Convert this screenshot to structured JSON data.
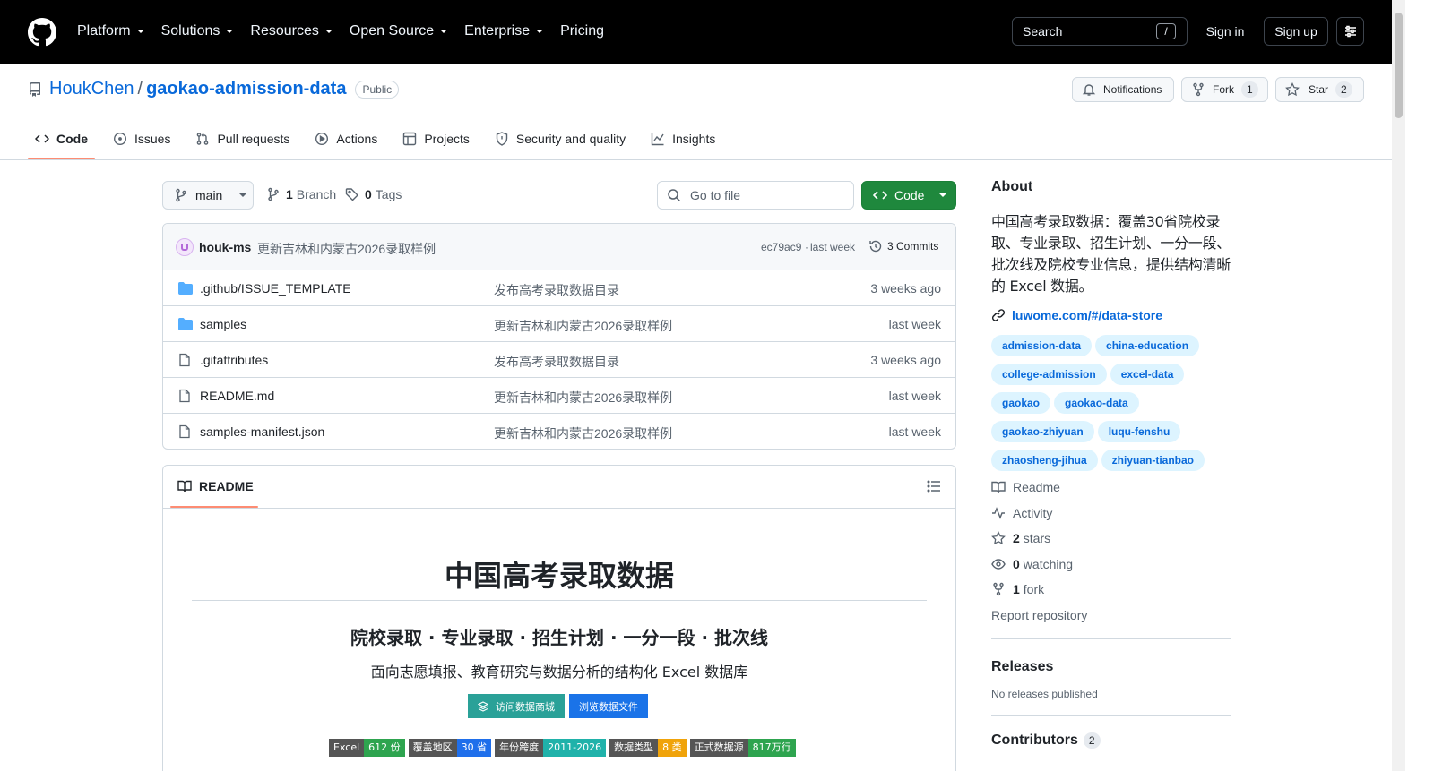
{
  "header": {
    "nav": [
      "Platform",
      "Solutions",
      "Resources",
      "Open Source",
      "Enterprise",
      "Pricing"
    ],
    "search_label": "Search",
    "search_kbd": "/",
    "sign_in": "Sign in",
    "sign_up": "Sign up"
  },
  "repo": {
    "owner": "HoukChen",
    "sep": "/",
    "name": "gaokao-admission-data",
    "visibility": "Public",
    "notifications_label": "Notifications",
    "fork_label": "Fork",
    "fork_count": "1",
    "star_label": "Star",
    "star_count": "2"
  },
  "tabs": [
    "Code",
    "Issues",
    "Pull requests",
    "Actions",
    "Projects",
    "Security and quality",
    "Insights"
  ],
  "toolbar": {
    "branch": "main",
    "branch_count": "1",
    "branch_label": "Branch",
    "tag_count": "0",
    "tag_label": "Tags",
    "goto_placeholder": "Go to file",
    "code_label": "Code"
  },
  "commit": {
    "author": "houk-ms",
    "message": "更新吉林和内蒙古2026录取样例",
    "hash": "ec79ac9",
    "dot": "·",
    "time": "last week",
    "commits_label": "3 Commits"
  },
  "files": [
    {
      "type": "folder",
      "name": ".github/ISSUE_TEMPLATE",
      "message": "发布高考录取数据目录",
      "time": "3 weeks ago"
    },
    {
      "type": "folder",
      "name": "samples",
      "message": "更新吉林和内蒙古2026录取样例",
      "time": "last week"
    },
    {
      "type": "file",
      "name": ".gitattributes",
      "message": "发布高考录取数据目录",
      "time": "3 weeks ago"
    },
    {
      "type": "file",
      "name": "README.md",
      "message": "更新吉林和内蒙古2026录取样例",
      "time": "last week"
    },
    {
      "type": "file",
      "name": "samples-manifest.json",
      "message": "更新吉林和内蒙古2026录取样例",
      "time": "last week"
    }
  ],
  "readme": {
    "tab_label": "README",
    "title": "中国高考录取数据",
    "subtitle": "院校录取 · 专业录取 · 招生计划 · 一分一段 · 批次线",
    "description": "面向志愿填报、教育研究与数据分析的结构化 Excel 数据库",
    "btn_store": "访问数据商城",
    "btn_browse": "浏览数据文件",
    "shields": [
      {
        "label": "Excel",
        "value": "612 份",
        "color": "#2ea44f"
      },
      {
        "label": "覆盖地区",
        "value": "30 省",
        "color": "#1f6feb"
      },
      {
        "label": "年份跨度",
        "value": "2011-2026",
        "color": "#20b2aa"
      },
      {
        "label": "数据类型",
        "value": "8 类",
        "color": "#f0a30a"
      },
      {
        "label": "正式数据源",
        "value": "817万行",
        "color": "#2ea44f"
      }
    ]
  },
  "about": {
    "heading": "About",
    "description": "中国高考录取数据：覆盖30省院校录取、专业录取、招生计划、一分一段、批次线及院校专业信息，提供结构清晰的 Excel 数据。",
    "link": "luwome.com/#/data-store",
    "topics": [
      "admission-data",
      "china-education",
      "college-admission",
      "excel-data",
      "gaokao",
      "gaokao-data",
      "gaokao-zhiyuan",
      "luqu-fenshu",
      "zhaosheng-jihua",
      "zhiyuan-tianbao"
    ],
    "readme": "Readme",
    "activity": "Activity",
    "stars_count": "2",
    "stars_label": "stars",
    "watching_count": "0",
    "watching_label": "watching",
    "forks_count": "1",
    "forks_label": "fork",
    "report": "Report repository"
  },
  "releases": {
    "heading": "Releases",
    "empty": "No releases published"
  },
  "contributors": {
    "heading": "Contributors",
    "count": "2"
  }
}
